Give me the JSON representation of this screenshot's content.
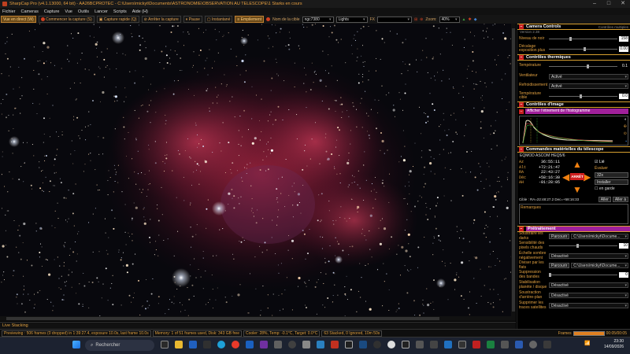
{
  "app": {
    "title": "SharpCap Pro (v4.1.13000, 64 bit) - AA26BCPROTEC - C:\\Users\\mickyt\\Documents\\ASTRONOMIE\\OBSERVATION AU TELESCOPE\\1 Starks en cours",
    "window_controls": [
      "–",
      "□",
      "✕"
    ]
  },
  "menu": [
    "Fichier",
    "Cameras",
    "Capture",
    "Vue",
    "Outils",
    "Lancer",
    "Scripts",
    "Aide (H)"
  ],
  "toolbar": {
    "live_view": "Vue en direct (W)",
    "start_capture": "Commencer la capture (S)",
    "quick_capture": "Capture rapide (Q)",
    "stop_capture": "Arrêter la capture",
    "pause": "Pause",
    "snapshot": "Instantané",
    "stacking": "Empilement",
    "target_label": "Nom de la cible",
    "target_value": "ngc7380",
    "frame_type": "Lights",
    "fx_label": "FX",
    "zoom_label": "Zoom:",
    "zoom_value": "40%"
  },
  "panel": {
    "camera_controls": {
      "title": "Camera Controls",
      "subtitle": "Version 2.38",
      "checkbox": "Contrôles multiples",
      "gain_label": "Niveau de noir",
      "gain_value": "158",
      "exposure_label": "Décalage exposition plus",
      "exposure_value": "0.00"
    },
    "thermal": {
      "title": "Contrôles thermiques",
      "temp_label": "Température",
      "temp_value": "0.1",
      "fan_label": "Ventilateur",
      "fan_value": "Activé",
      "cooling_label": "Refroidissement",
      "cooling_value": "Activé",
      "target_label": "Température cible",
      "target_value": "0.0"
    },
    "image": {
      "title": "Contrôles d'image",
      "histogram_label": "Afficher l'étirement de l'histogramme"
    },
    "telescope": {
      "title": "Commandes matérielles du télescope",
      "mount": "EQMOD ASCOM HEQ5/6",
      "coords": [
        {
          "k": "Az",
          "v": "36:55:11"
        },
        {
          "k": "Alt",
          "v": "+72:21:47"
        },
        {
          "k": "RA",
          "v": "22:43:27"
        },
        {
          "k": "Déc",
          "v": "+58:16:30"
        },
        {
          "k": "AH",
          "v": "-01:28:05"
        }
      ],
      "slew": "ARRÊT",
      "live_check": "Lié",
      "tracking": "Évaluer",
      "rate": "32x",
      "install": "Installer",
      "park": "en garde",
      "target_line": "Cible : RA=22:48:27.2 Dec=+58:16:33",
      "go_btn": "Aller",
      "goto_btn": "Aller à",
      "remarks_label": "Remarques"
    },
    "preprocessing": {
      "title": "Prétraitement",
      "dark_label": "Soustraire les darks",
      "dark_value": "Parcourir",
      "dark_path": "C:\\Users\\mickyt\\Docume...",
      "hotpix_label": "Sensibilité des pixels chauds",
      "hotpix_value": "10",
      "correct_label": "Échelle sombre négativement",
      "correct_value": "Désactivé",
      "flat_label": "Diviser par les flats",
      "flat_value": "Parcourir",
      "flat_path": "C:\\Users\\mickyt\\Docume...",
      "banding_label": "Suppression des bandes",
      "banding_value": "0",
      "stabilise_label": "Stabilisation planète / disque",
      "stabilise_value": "Désactivé",
      "bg_label": "Soustraction d'arrière-plan",
      "bg_value": "Désactivé",
      "sat_label": "Supprimer les traces satellites",
      "sat_value": "Désactivé"
    }
  },
  "live_tab": "Live Stacking",
  "status": {
    "previewing": "Previewing : 506 frames (0 dropped) in 1:39:27.4, exposure 10.0s, last frame 10.0s",
    "memory": "Memory: 1 of 51 frames used, Disk: 343 GB free",
    "cooler": "Cooler: 28%, Temp: -0.1°C, Target: 0.0°C",
    "stacked": "63 Stacked, 0 Ignored, 10m 50s",
    "frames_label": "Frames",
    "frames_count": "00:05/00:05",
    "frames_progress": 1.0
  },
  "taskbar": {
    "search_placeholder": "Rechercher",
    "time": "23:30",
    "date": "14/09/2026"
  }
}
